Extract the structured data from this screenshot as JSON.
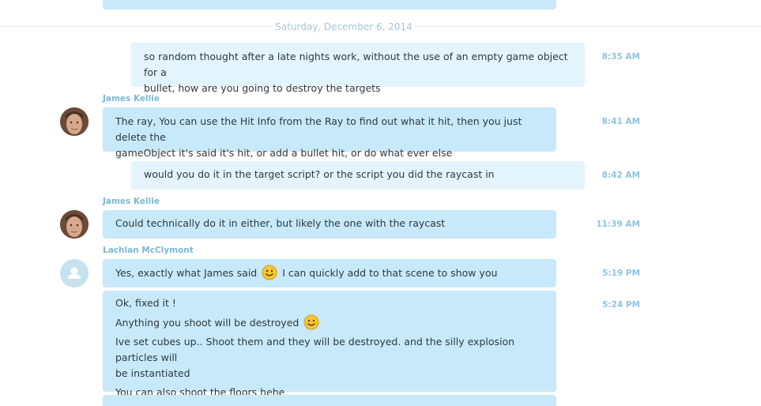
{
  "date_divider": "Saturday, December 6, 2014",
  "messages": [
    {
      "lines": [
        "so random thought after a late nights work, without the use of an empty game object for a",
        "bullet, how are you going to destroy the targets"
      ],
      "time": "8:35 AM"
    },
    {
      "sender": "James Kellie",
      "lines": [
        "The ray, You can use the Hit Info from the Ray to find out what it hit, then you just delete the",
        "gameObject it's said it's hit, or add a bullet hit, or do what ever else"
      ],
      "time": "8:41 AM"
    },
    {
      "lines": [
        "would you do it in the target script? or the script you did the raycast in"
      ],
      "time": "8:42 AM"
    },
    {
      "sender": "James Kellie",
      "lines": [
        "Could technically do it in either, but likely the one with the raycast"
      ],
      "time": "11:39 AM"
    },
    {
      "sender": "Lachlan McClymont",
      "before_emoji": "Yes, exactly what James said",
      "after_emoji": "I can quickly add to that scene to show you",
      "time": "5:19 PM"
    },
    {
      "line1": "Ok, fixed it !",
      "line2": "Anything you shoot will be destroyed",
      "line3a": "Ive set cubes up.. Shoot them and they will be destroyed. and the silly explosion particles will",
      "line3b": "be instantiated",
      "line4": "You can also shoot the floors hehe",
      "time": "5:24 PM"
    }
  ],
  "icons": {
    "smiley": "smiley-icon",
    "user": "user-icon"
  },
  "colors": {
    "incoming": "#c7e9fa",
    "outgoing": "#e3f4fc",
    "timestamp": "#8fc4dd",
    "sender": "#7bb8d4"
  }
}
